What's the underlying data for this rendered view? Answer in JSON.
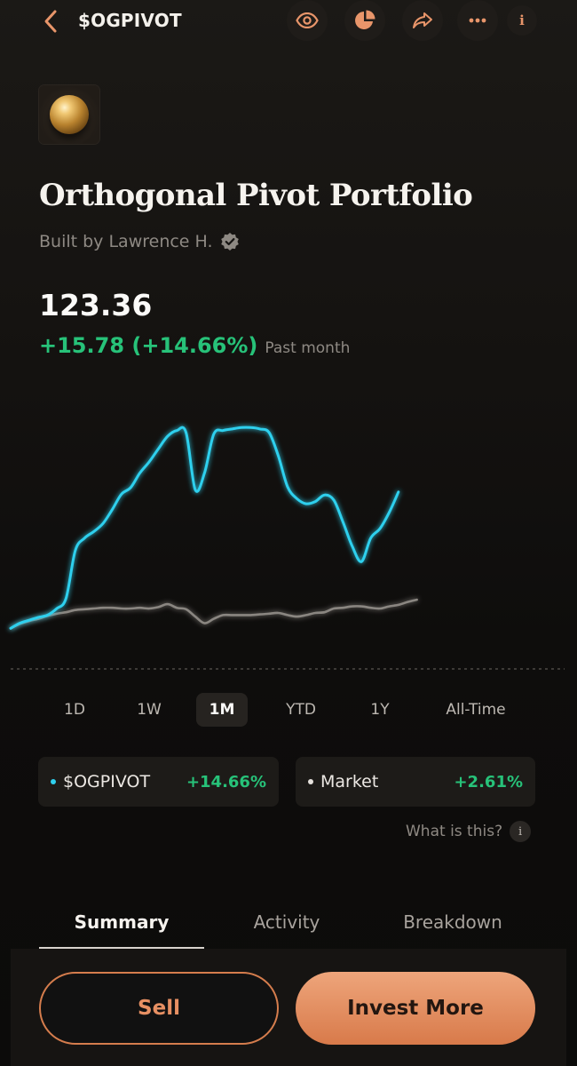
{
  "header": {
    "ticker": "$OGPIVOT",
    "icons": [
      "back-chevron-icon",
      "eye-icon",
      "pie-chart-icon",
      "share-icon",
      "more-icon",
      "info-icon"
    ],
    "info_glyph": "i"
  },
  "portfolio": {
    "title": "Orthogonal Pivot Portfolio",
    "byline": "Built by Lawrence H.",
    "price": "123.36",
    "change": "+15.78 (+14.66%)",
    "period": "Past month"
  },
  "colors": {
    "accent": "#e8956a",
    "positive": "#27c279",
    "portfolio_line": "#2fd0ee",
    "market_line": "#8a8681"
  },
  "ranges": {
    "items": [
      "1D",
      "1W",
      "1M",
      "YTD",
      "1Y",
      "All-Time"
    ],
    "active": "1M"
  },
  "comparison": {
    "portfolio": {
      "label": "$OGPIVOT",
      "value": "+14.66%",
      "dot_color": "#2fd0ee"
    },
    "market": {
      "label": "Market",
      "value": "+2.61%",
      "dot_color": "#e6e2dd"
    },
    "help": "What is this?"
  },
  "tabs": {
    "items": [
      "Summary",
      "Activity",
      "Breakdown"
    ],
    "active": "Summary"
  },
  "actions": {
    "sell": "Sell",
    "invest": "Invest More"
  },
  "chart_data": {
    "type": "line",
    "title": "",
    "xlabel": "",
    "ylabel": "",
    "grid": false,
    "x": [
      0,
      1,
      2,
      3,
      4,
      5,
      6,
      7,
      8,
      9,
      10,
      11,
      12,
      13,
      14,
      15,
      16,
      17,
      18,
      19,
      20,
      21,
      22,
      23,
      24,
      25,
      26,
      27,
      28,
      29,
      30,
      31,
      32,
      33,
      34,
      35,
      36,
      37,
      38,
      39,
      40,
      41,
      42,
      43,
      44,
      45,
      46,
      47,
      48,
      49,
      50,
      51,
      52,
      53,
      54,
      55,
      56,
      57,
      58,
      59,
      60
    ],
    "series": [
      {
        "values": [
          107.6,
          108.3,
          108.7,
          109.1,
          109.4,
          110.3,
          111.7,
          118.2,
          119.9,
          120.8,
          121.9,
          123.8,
          125.9,
          126.8,
          128.8,
          130.3,
          132.1,
          133.8,
          134.6,
          134.3,
          126.5,
          128.8,
          134.1,
          134.6,
          134.8,
          135.0,
          135.0,
          134.8,
          134.3,
          131.1,
          126.9,
          125.3,
          124.6,
          124.9,
          125.8,
          125.1,
          122.1,
          118.8,
          116.7,
          119.9,
          121.2,
          123.4,
          126.2
        ]
      },
      {
        "values": [
          107.6,
          108.2,
          108.6,
          108.9,
          109.3,
          109.6,
          109.8,
          110.1,
          110.2,
          110.3,
          110.4,
          110.4,
          110.3,
          110.3,
          110.4,
          110.3,
          110.5,
          110.9,
          110.4,
          110.2,
          109.2,
          108.3,
          108.9,
          109.4,
          109.4,
          109.4,
          109.4,
          109.5,
          109.6,
          109.7,
          109.4,
          109.2,
          109.4,
          109.7,
          109.8,
          110.3,
          110.4,
          110.6,
          110.6,
          110.4,
          110.3,
          110.6,
          110.8,
          111.2,
          111.5
        ]
      }
    ],
    "x_domain": [
      0,
      60
    ],
    "y_domain": [
      100,
      140
    ]
  }
}
